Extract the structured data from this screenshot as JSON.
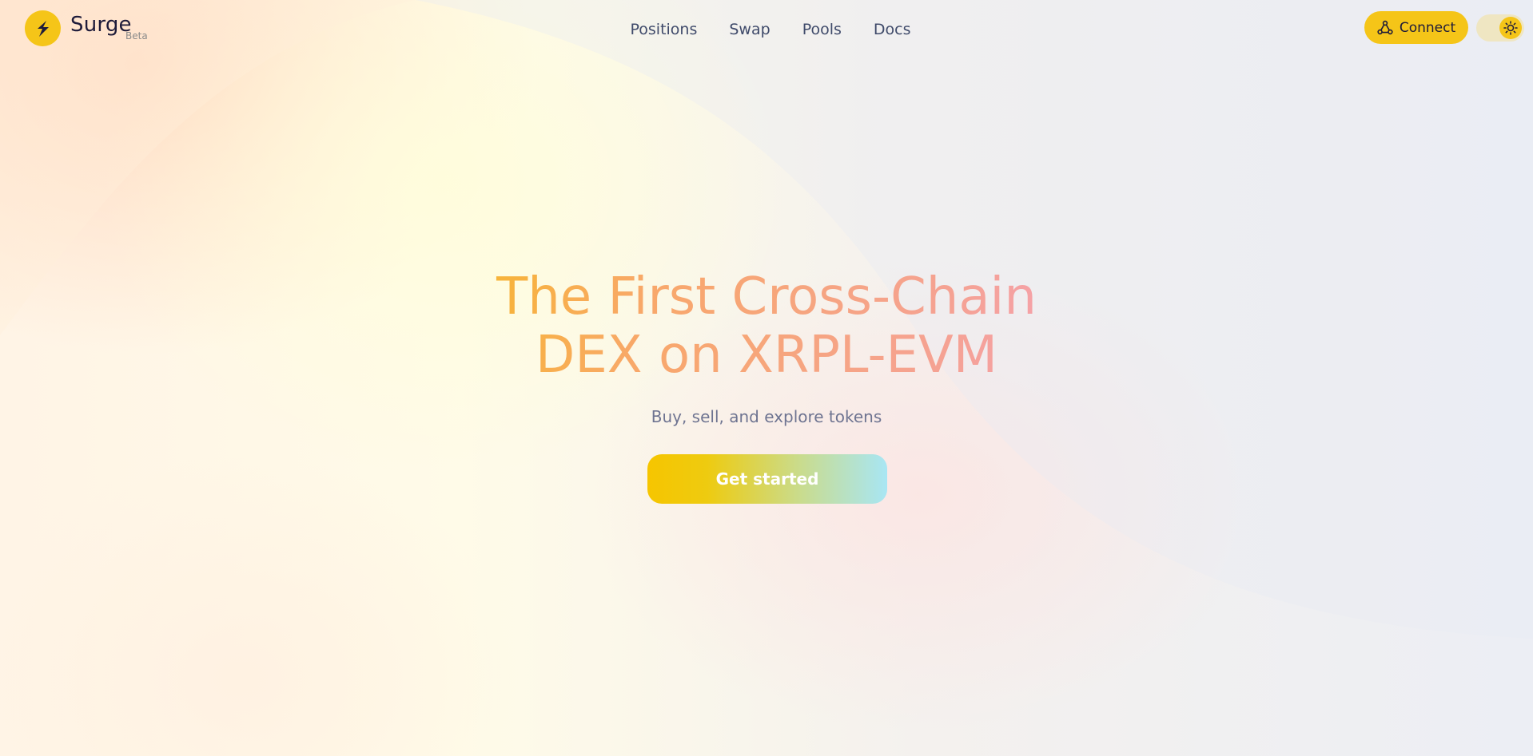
{
  "brand": {
    "name": "Surge",
    "badge": "Beta",
    "logo_icon": "lightning-bolt-icon",
    "accent_color": "#f5c518"
  },
  "nav": {
    "items": [
      {
        "label": "Positions"
      },
      {
        "label": "Swap"
      },
      {
        "label": "Pools"
      },
      {
        "label": "Docs"
      }
    ]
  },
  "header": {
    "connect_label": "Connect",
    "connect_icon": "network-nodes-icon",
    "theme_icon": "sun-icon"
  },
  "hero": {
    "title_line1": "The First Cross-Chain",
    "title_line2": "DEX on XRPL-EVM",
    "subtitle": "Buy, sell, and explore tokens",
    "cta_label": "Get started"
  }
}
